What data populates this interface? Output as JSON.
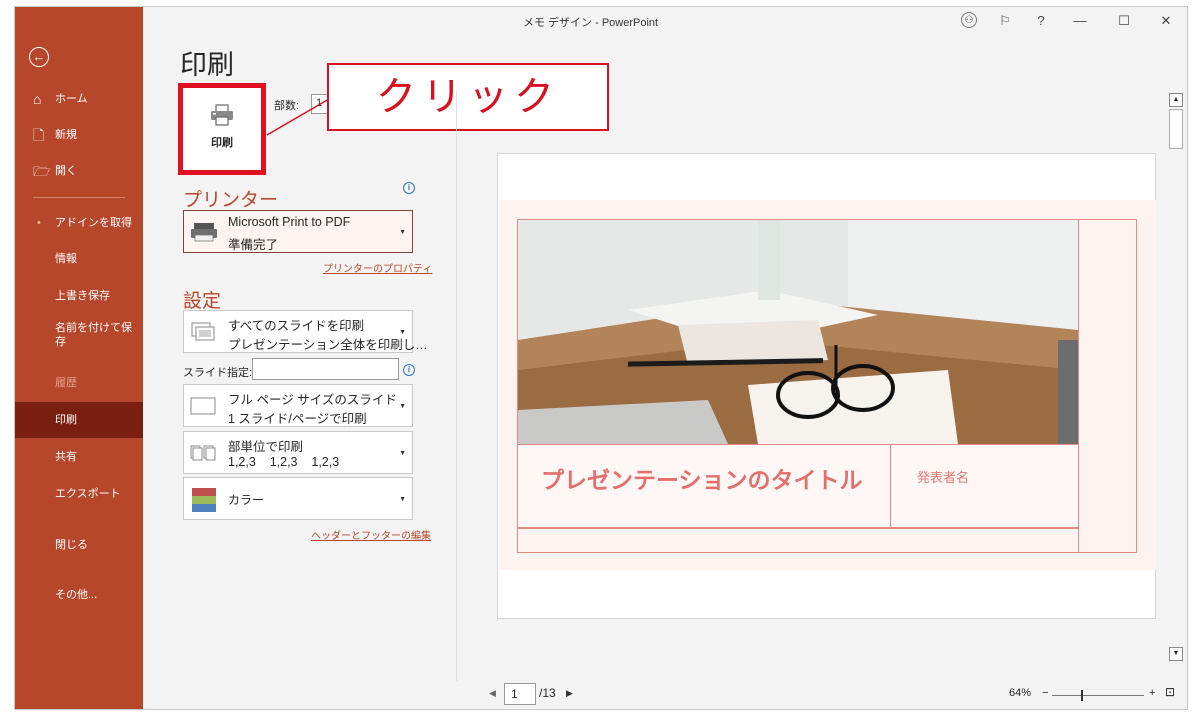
{
  "window": {
    "title": "メモ デザイン  -  PowerPoint",
    "help": "?"
  },
  "sidebar": {
    "items": [
      {
        "label": "ホーム",
        "icon": "home-icon"
      },
      {
        "label": "新規",
        "icon": "new-document-icon"
      },
      {
        "label": "開く",
        "icon": "open-folder-icon"
      },
      {
        "label": "アドインを取得",
        "icon": "bullet-dot"
      },
      {
        "label": "情報"
      },
      {
        "label": "上書き保存"
      },
      {
        "label": "名前を付けて保存"
      },
      {
        "label": "履歴"
      },
      {
        "label": "印刷"
      },
      {
        "label": "共有"
      },
      {
        "label": "エクスポート"
      },
      {
        "label": "閉じる"
      },
      {
        "label": "その他..."
      }
    ]
  },
  "print": {
    "title": "印刷",
    "button_label": "印刷",
    "copies_label": "部数:",
    "copies_value": "1",
    "callout": "クリック"
  },
  "printer": {
    "heading": "プリンター",
    "name": "Microsoft Print to PDF",
    "status": "準備完了",
    "properties_link": "プリンターのプロパティ"
  },
  "settings": {
    "heading": "設定",
    "range_line1": "すべてのスライドを印刷",
    "range_line2": "プレゼンテーション全体を印刷し…",
    "slides_label": "スライド指定:",
    "slides_value": "",
    "layout_line1": "フル ページ サイズのスライド",
    "layout_line2": "1 スライド/ページで印刷",
    "collate_line1": "部単位で印刷",
    "collate_line2": "1,2,3    1,2,3    1,2,3",
    "color": "カラー",
    "header_footer_link": "ヘッダーとフッターの編集"
  },
  "slide": {
    "title": "プレゼンテーションのタイトル",
    "presenter": "発表者名"
  },
  "pager": {
    "current": "1",
    "total": "/13"
  },
  "zoom": {
    "level": "64%",
    "minus": "−",
    "plus": "+"
  },
  "colors": {
    "accent": "#b7472a",
    "active_nav": "#7a1e10",
    "callout_red": "#d81020",
    "slide_title": "#e36e6a"
  }
}
